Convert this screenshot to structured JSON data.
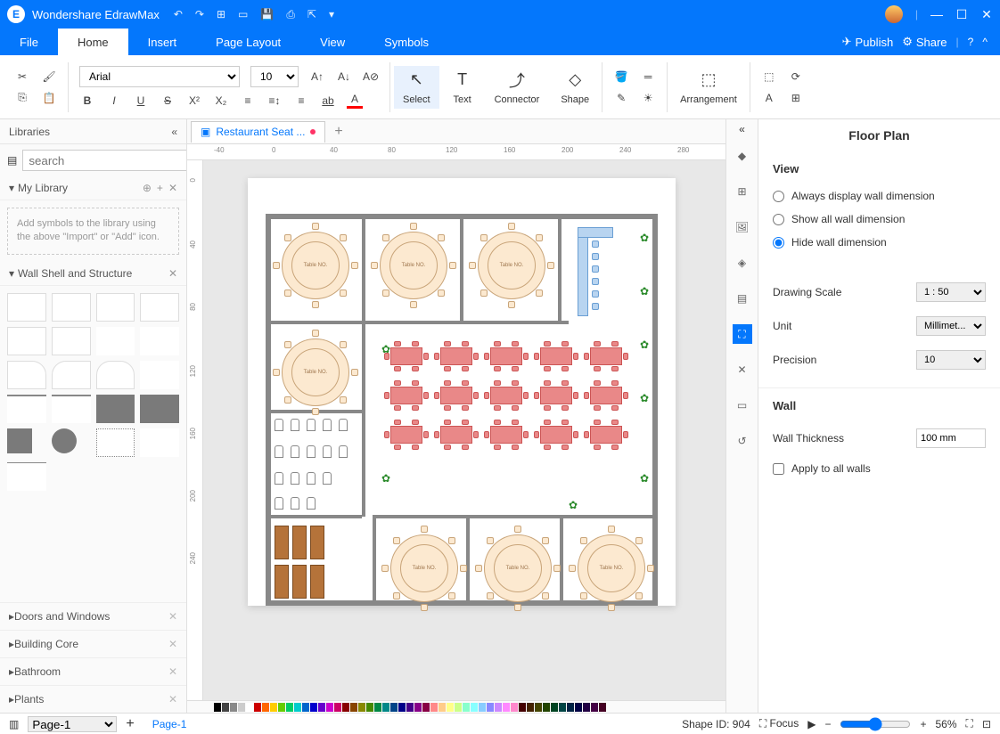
{
  "titlebar": {
    "app_name": "Wondershare EdrawMax"
  },
  "menubar": {
    "tabs": [
      "File",
      "Home",
      "Insert",
      "Page Layout",
      "View",
      "Symbols"
    ],
    "active": 1,
    "publish": "Publish",
    "share": "Share"
  },
  "ribbon": {
    "font": "Arial",
    "font_size": "10",
    "tools": {
      "select": "Select",
      "text": "Text",
      "connector": "Connector",
      "shape": "Shape",
      "arrangement": "Arrangement"
    }
  },
  "leftpanel": {
    "title": "Libraries",
    "search_placeholder": "search",
    "my_library": "My Library",
    "hint": "Add symbols to the library using the above \"Import\" or \"Add\" icon.",
    "section_wall": "Wall Shell and Structure",
    "categories": [
      "Doors and Windows",
      "Building Core",
      "Bathroom",
      "Plants"
    ]
  },
  "doctab": {
    "name": "Restaurant Seat ..."
  },
  "ruler_h": [
    "-40",
    "0",
    "40",
    "80",
    "120",
    "160",
    "200",
    "240",
    "280"
  ],
  "ruler_v": [
    "0",
    "40",
    "80",
    "120",
    "160",
    "200",
    "240"
  ],
  "canvas": {
    "table_label": "Table NO."
  },
  "rightpanel": {
    "title": "Floor Plan",
    "view_label": "View",
    "radios": [
      "Always display wall dimension",
      "Show all wall dimension",
      "Hide wall dimension"
    ],
    "radio_selected": 2,
    "scale_label": "Drawing Scale",
    "scale_value": "1 : 50",
    "unit_label": "Unit",
    "unit_value": "Millimet...",
    "precision_label": "Precision",
    "precision_value": "10",
    "wall_label": "Wall",
    "thickness_label": "Wall Thickness",
    "thickness_value": "100 mm",
    "apply_label": "Apply to all walls"
  },
  "statusbar": {
    "page_selector": "Page-1",
    "page_tab": "Page-1",
    "shape_id": "Shape ID: 904",
    "focus": "Focus",
    "zoom": "56%"
  },
  "colors": [
    "#000",
    "#444",
    "#888",
    "#ccc",
    "#fff",
    "#c00",
    "#f60",
    "#fc0",
    "#6c0",
    "#0c6",
    "#0cc",
    "#06c",
    "#00c",
    "#60c",
    "#c0c",
    "#c06",
    "#800",
    "#840",
    "#880",
    "#480",
    "#084",
    "#088",
    "#048",
    "#008",
    "#408",
    "#808",
    "#804",
    "#f88",
    "#fc8",
    "#ff8",
    "#cf8",
    "#8fc",
    "#8ff",
    "#8cf",
    "#88f",
    "#c8f",
    "#f8f",
    "#f8c",
    "#400",
    "#420",
    "#440",
    "#240",
    "#042",
    "#044",
    "#024",
    "#004",
    "#204",
    "#404",
    "#402"
  ]
}
